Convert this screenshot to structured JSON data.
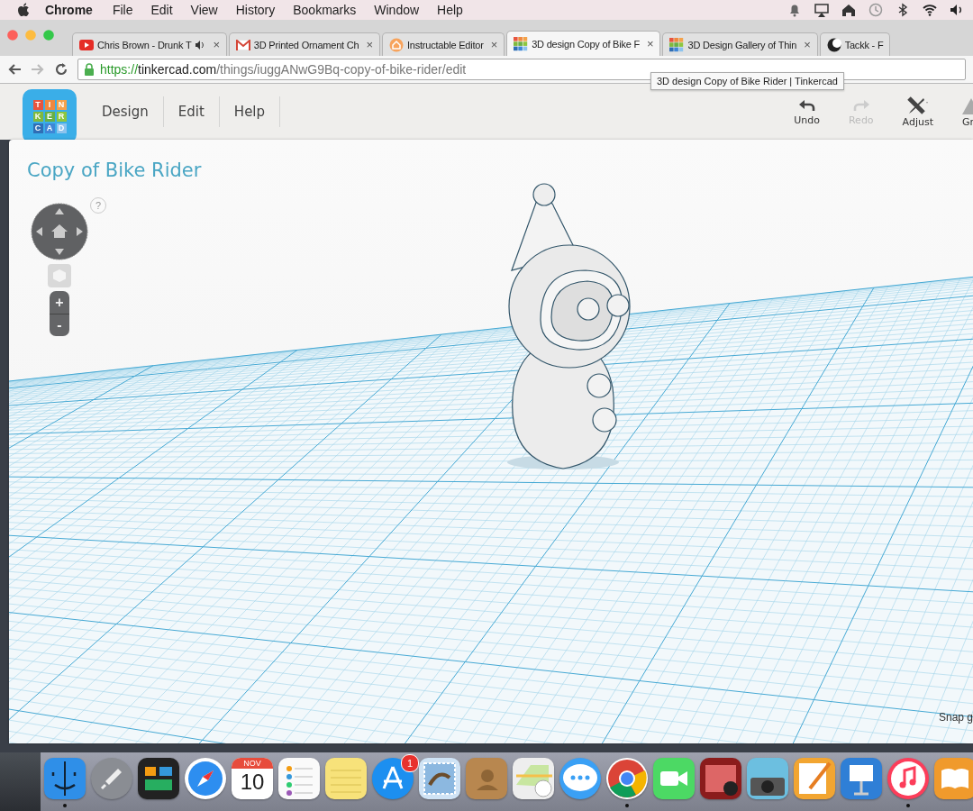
{
  "menubar": {
    "app": "Chrome",
    "menus": [
      "File",
      "Edit",
      "View",
      "History",
      "Bookmarks",
      "Window",
      "Help"
    ]
  },
  "browser": {
    "tabs": [
      {
        "title": "Chris Brown - Drunk T",
        "kind": "video",
        "audio": true,
        "close": "×",
        "selected": false
      },
      {
        "title": "3D Printed Ornament Ch",
        "kind": "mail",
        "audio": false,
        "close": "×",
        "selected": false
      },
      {
        "title": "Instructable Editor",
        "kind": "house",
        "audio": false,
        "close": "×",
        "selected": false
      },
      {
        "title": "3D design Copy of Bike F",
        "kind": "grid",
        "audio": false,
        "close": "×",
        "selected": true
      },
      {
        "title": "3D Design Gallery of Thin",
        "kind": "grid",
        "audio": false,
        "close": "×",
        "selected": false
      },
      {
        "title": "Tackk - F",
        "kind": "crescent",
        "audio": false,
        "selected": false
      }
    ],
    "forward_disabled": true,
    "url": {
      "scheme": "https://",
      "host": "tinkercad.com",
      "path": "/things/iuggANwG9Bq-copy-of-bike-rider/edit"
    },
    "tooltip": "3D design Copy of Bike Rider | Tinkercad"
  },
  "app": {
    "logo": [
      "T",
      "I",
      "N",
      "K",
      "E",
      "R",
      "C",
      "A",
      "D"
    ],
    "menus": [
      "Design",
      "Edit",
      "Help"
    ],
    "tools": [
      {
        "kind": "undo",
        "label": "Undo",
        "disabled": false
      },
      {
        "kind": "redo",
        "label": "Redo",
        "disabled": true
      },
      {
        "kind": "adjust",
        "label": "Adjust",
        "disabled": false
      },
      {
        "kind": "group",
        "label": "Gr",
        "disabled": false
      }
    ]
  },
  "design": {
    "title": "Copy of Bike Rider",
    "help": "?",
    "zoom_in": "+",
    "zoom_out": "-",
    "snap_label": "Snap g"
  },
  "dock": [
    {
      "kind": "finder",
      "running": true
    },
    {
      "kind": "launchpad",
      "running": false
    },
    {
      "kind": "mission",
      "running": false
    },
    {
      "kind": "safari",
      "running": false
    },
    {
      "kind": "calendar",
      "running": false,
      "month": "NOV",
      "day": "10"
    },
    {
      "kind": "reminders",
      "running": false
    },
    {
      "kind": "notes",
      "running": false
    },
    {
      "kind": "appstore",
      "running": false,
      "badge": "1"
    },
    {
      "kind": "mail",
      "running": false
    },
    {
      "kind": "contacts",
      "running": false
    },
    {
      "kind": "maps",
      "running": false
    },
    {
      "kind": "messages",
      "running": false
    },
    {
      "kind": "chrome",
      "running": true
    },
    {
      "kind": "facetime",
      "running": false
    },
    {
      "kind": "photobooth",
      "running": false
    },
    {
      "kind": "iphoto",
      "running": false
    },
    {
      "kind": "pages",
      "running": false
    },
    {
      "kind": "keynote",
      "running": false
    },
    {
      "kind": "itunes",
      "running": true
    },
    {
      "kind": "ibooks",
      "running": false
    }
  ]
}
